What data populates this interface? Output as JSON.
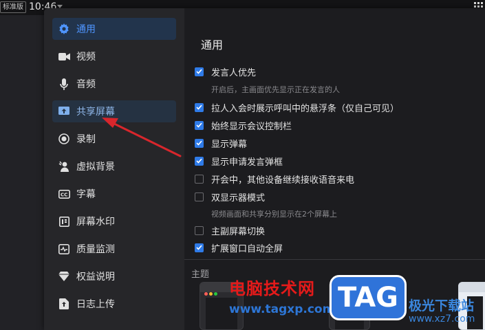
{
  "topbar": {
    "edition_badge": "标准版",
    "clock": "10:46"
  },
  "sidebar": {
    "items": [
      {
        "label": "通用",
        "icon": "gear-icon",
        "state": "selected"
      },
      {
        "label": "视频",
        "icon": "video-camera-icon"
      },
      {
        "label": "音频",
        "icon": "microphone-icon"
      },
      {
        "label": "共享屏幕",
        "icon": "share-screen-icon",
        "state": "highlighted"
      },
      {
        "label": "录制",
        "icon": "record-icon"
      },
      {
        "label": "虚拟背景",
        "icon": "virtual-background-icon"
      },
      {
        "label": "字幕",
        "icon": "caption-icon"
      },
      {
        "label": "屏幕水印",
        "icon": "watermark-icon"
      },
      {
        "label": "质量监测",
        "icon": "pulse-icon"
      },
      {
        "label": "权益说明",
        "icon": "diamond-icon"
      },
      {
        "label": "日志上传",
        "icon": "upload-icon"
      }
    ]
  },
  "content": {
    "title": "通用",
    "options": [
      {
        "label": "发言人优先",
        "checked": true,
        "hint": "开启后，主画面优先显示正在发言的人"
      },
      {
        "label": "拉人入会时展示呼叫中的悬浮条（仅自己可见）",
        "checked": true
      },
      {
        "label": "始终显示会议控制栏",
        "checked": true
      },
      {
        "label": "显示弹幕",
        "checked": true
      },
      {
        "label": "显示申请发言弹框",
        "checked": true
      },
      {
        "label": "开会中，其他设备继续接收语音来电",
        "checked": false
      },
      {
        "label": "双显示器模式",
        "checked": false,
        "hint": "视频画面和共享分别显示在2个屏幕上"
      },
      {
        "label": "主副屏幕切换",
        "checked": false
      },
      {
        "label": "扩展窗口自动全屏",
        "checked": true
      }
    ],
    "theme_label": "主题"
  },
  "watermark": {
    "site_name": "电脑技术网",
    "site_url": "www.tagxp.com",
    "tag_logo": "TAG",
    "site_name_2": "极光下载站",
    "site_url_2": "www.xz7.com"
  },
  "colors": {
    "accent": "#2f7be8",
    "selected_text": "#4f95ff",
    "arrow": "#d8262c"
  }
}
